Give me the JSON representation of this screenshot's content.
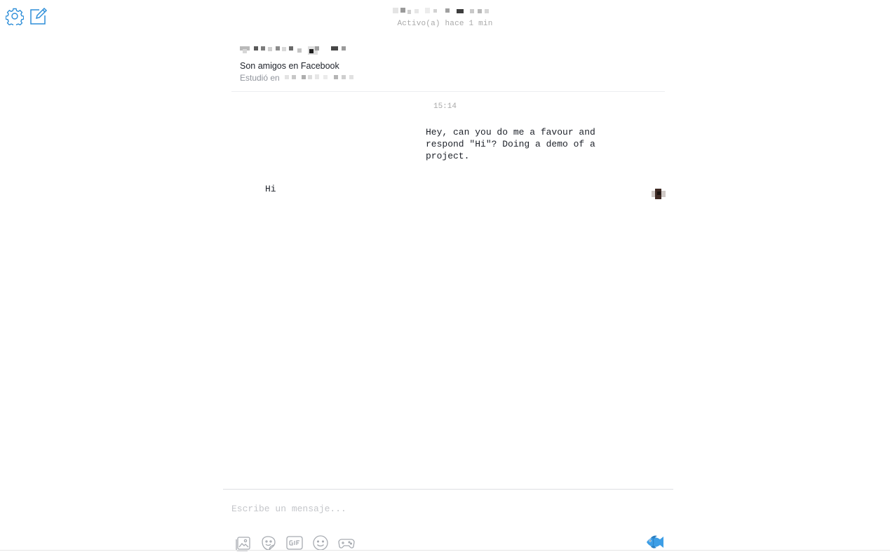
{
  "header": {
    "status": "Activo(a) hace 1 min"
  },
  "profile": {
    "friends_text": "Son amigos en Facebook",
    "studied_label": "Estudió en"
  },
  "conversation": {
    "timestamp": "15:14",
    "messages": [
      {
        "direction": "outgoing",
        "text": "Hey, can you do me a favour and respond \"Hi\"? Doing a demo of a project."
      },
      {
        "direction": "incoming",
        "text": "Hi"
      }
    ]
  },
  "composer": {
    "placeholder": "Escribe un mensaje...",
    "value": "",
    "tools": [
      "photo-icon",
      "sticker-icon",
      "gif-icon",
      "emoji-icon",
      "games-icon"
    ],
    "like_icon": "fish-emoji-icon"
  },
  "toolbar_icons": [
    "gear-icon",
    "compose-icon"
  ],
  "colors": {
    "accent": "#2d8ed8",
    "tool_icon": "#a7abb1"
  }
}
